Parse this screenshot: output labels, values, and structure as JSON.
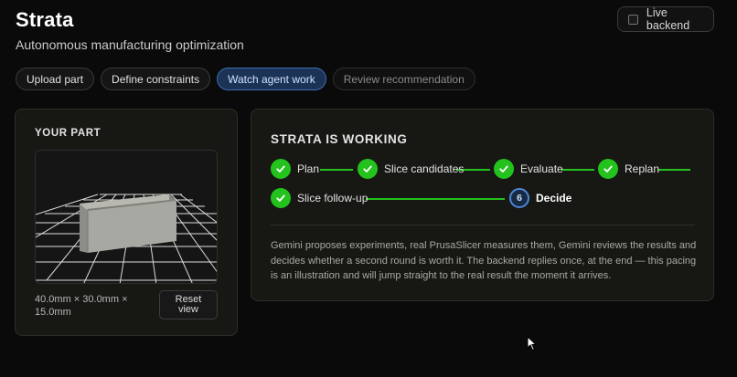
{
  "header": {
    "title": "Strata",
    "subtitle": "Autonomous manufacturing optimization",
    "live_backend_label": "Live backend",
    "live_backend_checked": false
  },
  "tabs": [
    {
      "label": "Upload part",
      "state": "done"
    },
    {
      "label": "Define constraints",
      "state": "done"
    },
    {
      "label": "Watch agent work",
      "state": "active"
    },
    {
      "label": "Review recommendation",
      "state": "upcoming"
    }
  ],
  "part_panel": {
    "heading": "YOUR PART",
    "dimensions": "40.0mm × 30.0mm × 15.0mm",
    "reset_label": "Reset view"
  },
  "work_panel": {
    "heading": "STRATA IS WORKING",
    "steps": [
      {
        "label": "Plan",
        "status": "done"
      },
      {
        "label": "Slice candidates",
        "status": "done"
      },
      {
        "label": "Evaluate",
        "status": "done"
      },
      {
        "label": "Replan",
        "status": "done"
      },
      {
        "label": "Slice follow-up",
        "status": "done"
      },
      {
        "label": "Decide",
        "status": "current",
        "number": "6"
      }
    ],
    "description": "Gemini proposes experiments, real PrusaSlicer measures them, Gemini reviews the results and decides whether a second round is worth it. The backend replies once, at the end — this pacing is an illustration and will jump straight to the real result the moment it arrives."
  },
  "colors": {
    "background": "#0a0a0a",
    "done_green": "#23c21d",
    "active_tab_blue": "#1c3358",
    "current_step_ring": "#4f86d8"
  }
}
